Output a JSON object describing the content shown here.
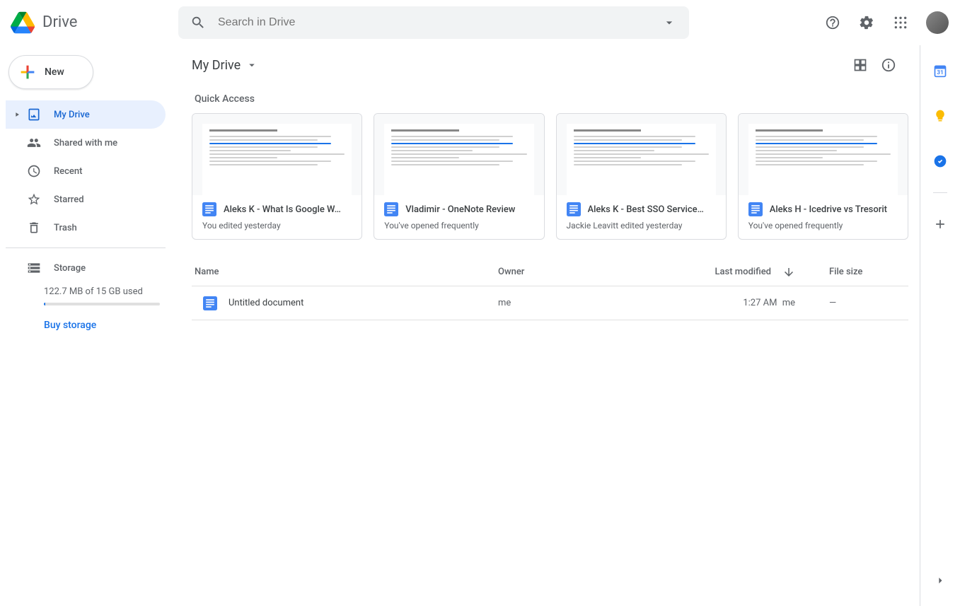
{
  "header": {
    "product_name": "Drive",
    "search_placeholder": "Search in Drive"
  },
  "sidebar": {
    "new_label": "New",
    "items": [
      {
        "label": "My Drive"
      },
      {
        "label": "Shared with me"
      },
      {
        "label": "Recent"
      },
      {
        "label": "Starred"
      },
      {
        "label": "Trash"
      }
    ],
    "storage_label": "Storage",
    "storage_used": "122.7 MB of 15 GB used",
    "buy_label": "Buy storage"
  },
  "breadcrumb": {
    "title": "My Drive"
  },
  "quick_access": {
    "title": "Quick Access",
    "cards": [
      {
        "title": "Aleks K - What Is Google W…",
        "subtitle": "You edited yesterday"
      },
      {
        "title": "Vladimir - OneNote Review",
        "subtitle": "You've opened frequently"
      },
      {
        "title": "Aleks K - Best SSO Service…",
        "subtitle": "Jackie Leavitt edited yesterday"
      },
      {
        "title": "Aleks H - Icedrive vs Tresorit",
        "subtitle": "You've opened frequently"
      }
    ]
  },
  "table": {
    "cols": {
      "name": "Name",
      "owner": "Owner",
      "modified": "Last modified",
      "size": "File size"
    },
    "rows": [
      {
        "name": "Untitled document",
        "owner": "me",
        "modified": "1:27 AM",
        "modified_by": "me",
        "size": "—"
      }
    ]
  }
}
